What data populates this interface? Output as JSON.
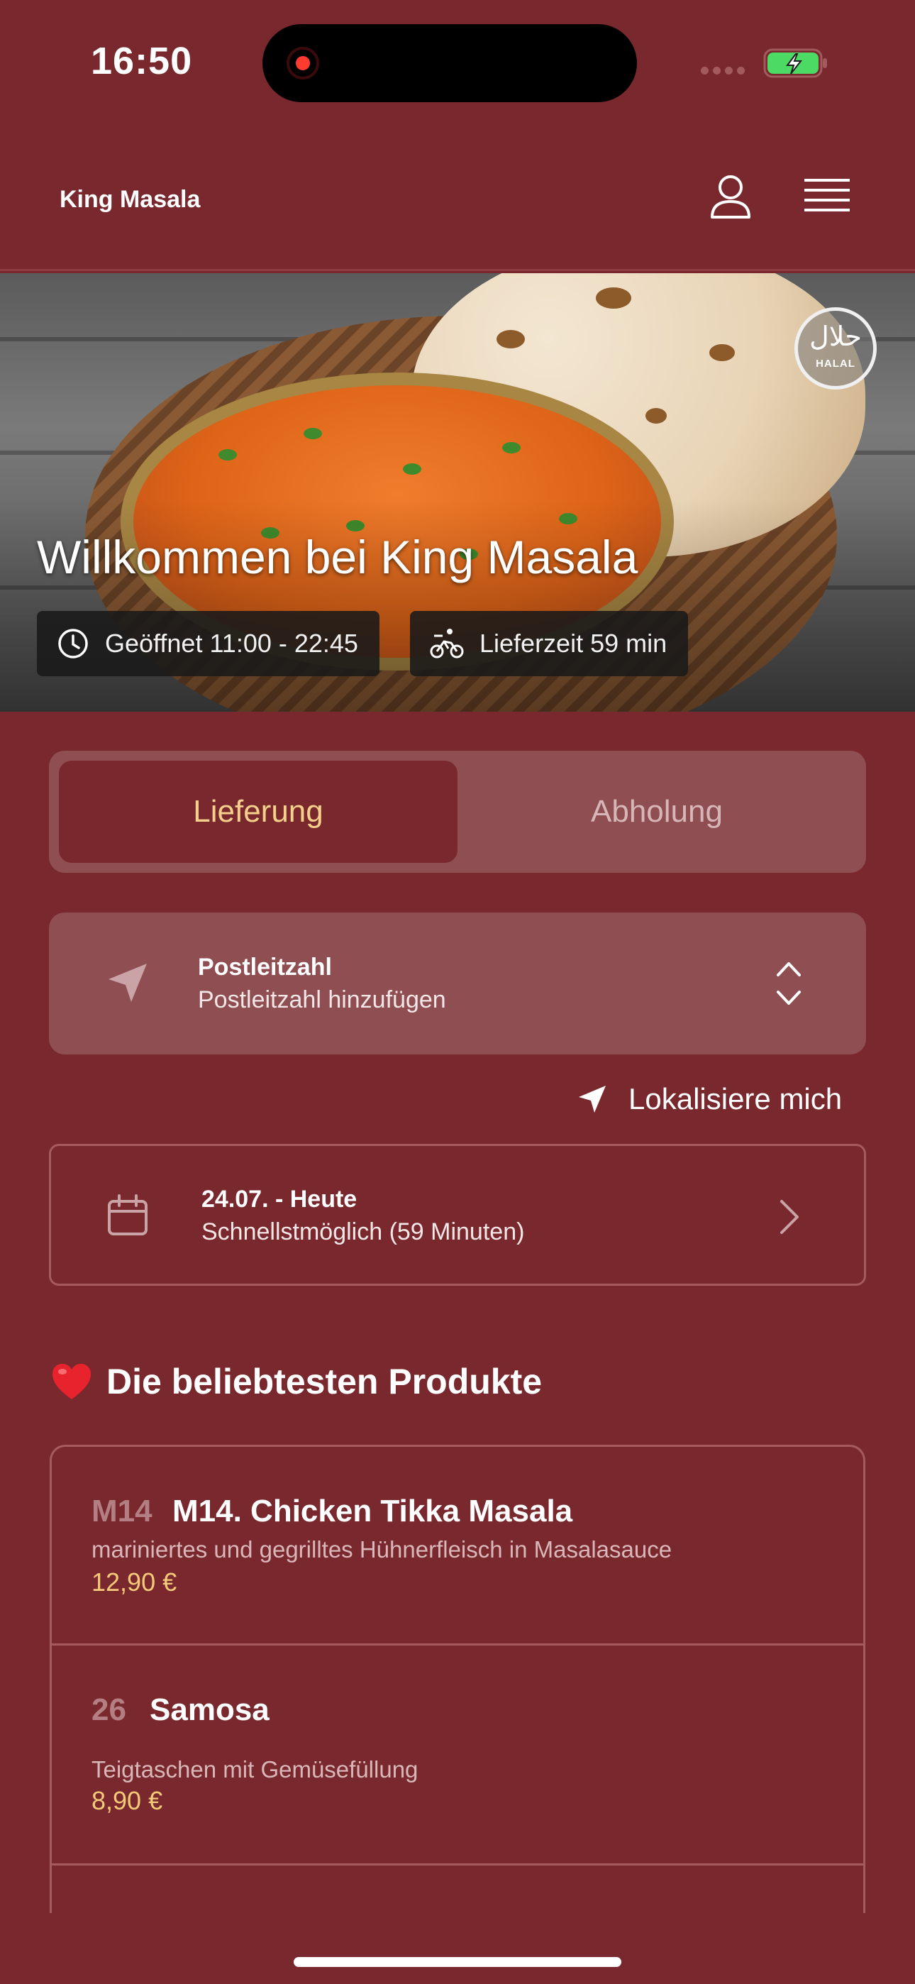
{
  "status_bar": {
    "time": "16:50"
  },
  "header": {
    "brand": "King Masala"
  },
  "hero": {
    "title": "Willkommen bei King Masala",
    "badge_arabic": "حلال",
    "badge_latin": "HALAL",
    "opening_hours": "Geöffnet 11:00 - 22:45",
    "delivery_time": "Lieferzeit 59 min"
  },
  "mode_toggle": {
    "delivery_label": "Lieferung",
    "pickup_label": "Abholung",
    "selected": "Lieferung"
  },
  "postal": {
    "title": "Postleitzahl",
    "placeholder": "Postleitzahl hinzufügen"
  },
  "locate": {
    "label": "Lokalisiere mich"
  },
  "schedule": {
    "date": "24.07. - Heute",
    "time": "Schnellstmöglich (59 Minuten)"
  },
  "popular": {
    "title": "Die beliebtesten Produkte",
    "items": [
      {
        "code": "M14",
        "name": "M14. Chicken Tikka Masala",
        "description": "mariniertes und gegrilltes Hühnerfleisch in Masalasauce",
        "price": "12,90 €"
      },
      {
        "code": "26",
        "name": "Samosa",
        "description": "Teigtaschen mit Gemüsefüllung",
        "price": "8,90 €"
      }
    ]
  },
  "colors": {
    "background": "#79282d",
    "card": "#8e4e52",
    "accent_price": "#f5c97a",
    "active_tab_text": "#f5d08c"
  },
  "icons": [
    "user-icon",
    "menu-icon",
    "clock-icon",
    "bicycle-icon",
    "location-arrow-icon",
    "chevron-updown-icon",
    "calendar-icon",
    "chevron-right-icon",
    "heart-icon",
    "halal-badge-icon",
    "battery-icon"
  ]
}
